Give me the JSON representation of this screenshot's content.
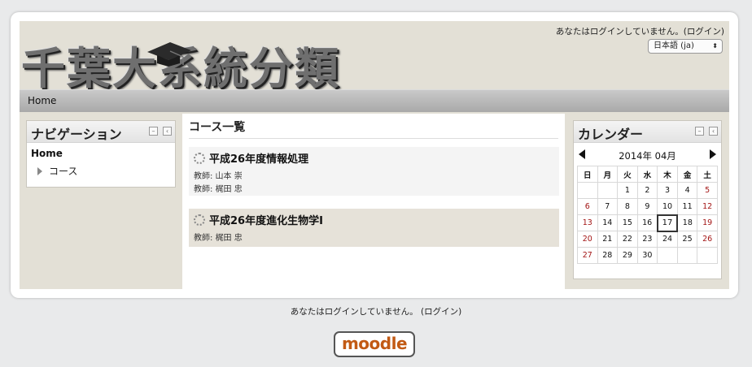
{
  "header": {
    "site_title": "千葉大系統分類",
    "login_text": "あなたはログインしていません。",
    "login_link": "(ログイン)",
    "language": "日本語 (ja)"
  },
  "navbar": {
    "home": "Home"
  },
  "navigation_block": {
    "title": "ナビゲーション",
    "home": "Home",
    "items": [
      {
        "label": "コース"
      }
    ]
  },
  "main": {
    "title": "コース一覧",
    "courses": [
      {
        "name": "平成26年度情報処理",
        "teachers": [
          "教師: 山本 崇",
          "教師: 梶田 忠"
        ]
      },
      {
        "name": "平成26年度進化生物学I",
        "teachers": [
          "教師: 梶田 忠"
        ]
      }
    ]
  },
  "calendar": {
    "title": "カレンダー",
    "month": "2014年 04月",
    "weekdays": [
      "日",
      "月",
      "火",
      "水",
      "木",
      "金",
      "土"
    ],
    "weeks": [
      [
        "",
        "",
        "1",
        "2",
        "3",
        "4",
        "5"
      ],
      [
        "6",
        "7",
        "8",
        "9",
        "10",
        "11",
        "12"
      ],
      [
        "13",
        "14",
        "15",
        "16",
        "17",
        "18",
        "19"
      ],
      [
        "20",
        "21",
        "22",
        "23",
        "24",
        "25",
        "26"
      ],
      [
        "27",
        "28",
        "29",
        "30",
        "",
        "",
        ""
      ]
    ],
    "today": "17"
  },
  "footer": {
    "login_text": "あなたはログインしていません。",
    "login_link": "(ログイン)",
    "logo": "moodle"
  }
}
